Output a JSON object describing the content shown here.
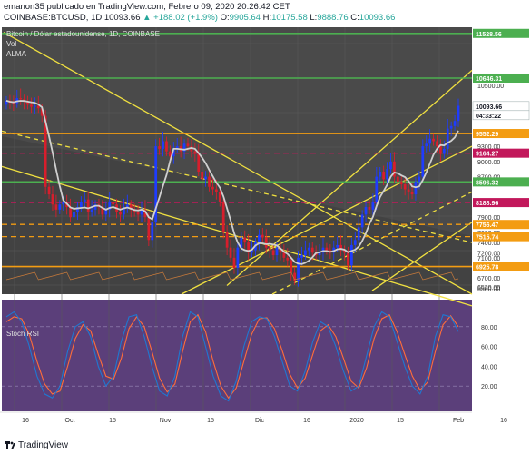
{
  "header": {
    "line1": "emanon35 publicado en TradingView.com, Febrero 09, 2020 20:26:42 CET",
    "symbol": "COINBASE:BTCUSD, 1D",
    "price": "10093.66",
    "change": "▲ +188.02 (+1.9%)",
    "o_label": "O:",
    "o": "9905.64",
    "h_label": "H:",
    "h": "10175.58",
    "l_label": "L:",
    "l": "9888.76",
    "c_label": "C:",
    "c": "10093.66"
  },
  "footer": {
    "brand": "TradingView"
  },
  "colors": {
    "bg_upper": "#4a4a4a",
    "bg_lower": "#3e3e3e",
    "bull": "#1e3cff",
    "bear": "#d81e2c",
    "channel": "#f0e040",
    "support_orange": "#f39c12",
    "level_green": "#4caf50",
    "level_red": "#c2185b",
    "alma": "#cfcfcf",
    "rsi_bg": "#5b3f7a",
    "rsi_k": "#1f78d1",
    "rsi_d": "#ff6d3a"
  },
  "chart_data": {
    "type": "candlestick",
    "title": "Bitcoin / Dólar estadounidense, 1D, COINBASE",
    "legend": [
      "Vol",
      "ALMA"
    ],
    "x_ticks": [
      "16",
      "Oct",
      "15",
      "Nov",
      "15",
      "Dic",
      "16",
      "2020",
      "15",
      "Feb",
      "16"
    ],
    "y_ticks": [
      10500,
      10000,
      9300,
      9000,
      8700,
      7900,
      7600,
      7400,
      7200,
      7100,
      6700,
      6520,
      6500
    ],
    "ylim": [
      6380,
      11650
    ],
    "price_labels": [
      {
        "value": "11528.56",
        "color": "#4caf50"
      },
      {
        "value": "10646.31",
        "color": "#4caf50"
      },
      {
        "value": "10093.66",
        "color": "#131722"
      },
      {
        "value": "04:33:22",
        "color": "#131722"
      },
      {
        "value": "9552.29",
        "color": "#f39c12"
      },
      {
        "value": "9164.27",
        "color": "#c2185b"
      },
      {
        "value": "8596.32",
        "color": "#4caf50"
      },
      {
        "value": "8188.96",
        "color": "#c2185b"
      },
      {
        "value": "7756.47",
        "color": "#f39c12"
      },
      {
        "value": "7515.74",
        "color": "#f39c12"
      },
      {
        "value": "6925.78",
        "color": "#f39c12"
      }
    ],
    "hlines": [
      {
        "value": 11528.56,
        "style": "solid",
        "color": "#4caf50"
      },
      {
        "value": 10646.31,
        "style": "solid",
        "color": "#4caf50"
      },
      {
        "value": 9552.29,
        "style": "solid",
        "color": "#f39c12"
      },
      {
        "value": 9164.27,
        "style": "dashed",
        "color": "#c2185b"
      },
      {
        "value": 8596.32,
        "style": "solid",
        "color": "#4caf50"
      },
      {
        "value": 8188.96,
        "style": "dashed",
        "color": "#c2185b"
      },
      {
        "value": 7756.47,
        "style": "dashed",
        "color": "#f39c12"
      },
      {
        "value": 7515.74,
        "style": "dashed",
        "color": "#f39c12"
      },
      {
        "value": 6925.78,
        "style": "solid",
        "color": "#f39c12"
      }
    ],
    "close_series": [
      10200,
      10160,
      10150,
      10250,
      10230,
      10180,
      10120,
      10080,
      10100,
      10050,
      9900,
      8500,
      8350,
      8150,
      8050,
      8150,
      8200,
      8100,
      7900,
      8000,
      8100,
      8200,
      8250,
      8000,
      8050,
      8150,
      8100,
      7950,
      8050,
      8200,
      8150,
      8000,
      7950,
      8100,
      8150,
      8050,
      8000,
      7950,
      8050,
      7900,
      7450,
      7800,
      9300,
      9250,
      9400,
      9200,
      9100,
      9250,
      9300,
      9200,
      9350,
      9300,
      9200,
      9150,
      8800,
      8650,
      8700,
      8500,
      8450,
      8400,
      8200,
      7600,
      7300,
      7100,
      6900,
      7300,
      7500,
      7400,
      7200,
      7250,
      7400,
      7550,
      7500,
      7300,
      7250,
      7150,
      7300,
      7200,
      7100,
      7050,
      6800,
      6650,
      7100,
      7150,
      7250,
      7300,
      7200,
      7150,
      7200,
      7300,
      7250,
      7200,
      7300,
      7350,
      7250,
      7200,
      6950,
      7350,
      7450,
      7700,
      7950,
      8100,
      8050,
      8200,
      8700,
      8800,
      8650,
      8850,
      9000,
      8700,
      8600,
      8550,
      8450,
      8400,
      8350,
      8600,
      8700,
      9300,
      9350,
      9450,
      9400,
      9300,
      9150,
      9250,
      9650,
      9700,
      9800,
      10100
    ],
    "rsi": {
      "name": "Stoch RSI",
      "ylim": [
        0,
        100
      ],
      "ticks": [
        80,
        60,
        40,
        20
      ],
      "k": [
        90,
        95,
        85,
        60,
        30,
        12,
        8,
        20,
        55,
        80,
        85,
        70,
        40,
        20,
        30,
        65,
        90,
        92,
        70,
        40,
        15,
        10,
        30,
        70,
        95,
        90,
        60,
        30,
        10,
        5,
        25,
        60,
        85,
        90,
        88,
        70,
        45,
        20,
        15,
        35,
        65,
        85,
        80,
        60,
        35,
        15,
        20,
        50,
        80,
        95,
        90,
        65,
        40,
        20,
        12,
        30,
        70,
        92,
        90,
        75
      ],
      "d": [
        85,
        90,
        88,
        72,
        45,
        22,
        12,
        15,
        40,
        68,
        82,
        76,
        52,
        30,
        27,
        48,
        78,
        90,
        80,
        55,
        28,
        14,
        22,
        55,
        85,
        92,
        75,
        45,
        20,
        8,
        18,
        45,
        72,
        88,
        89,
        78,
        56,
        32,
        18,
        28,
        52,
        76,
        82,
        70,
        48,
        25,
        18,
        38,
        68,
        88,
        92,
        75,
        52,
        30,
        16,
        24,
        55,
        82,
        91,
        80
      ]
    }
  }
}
